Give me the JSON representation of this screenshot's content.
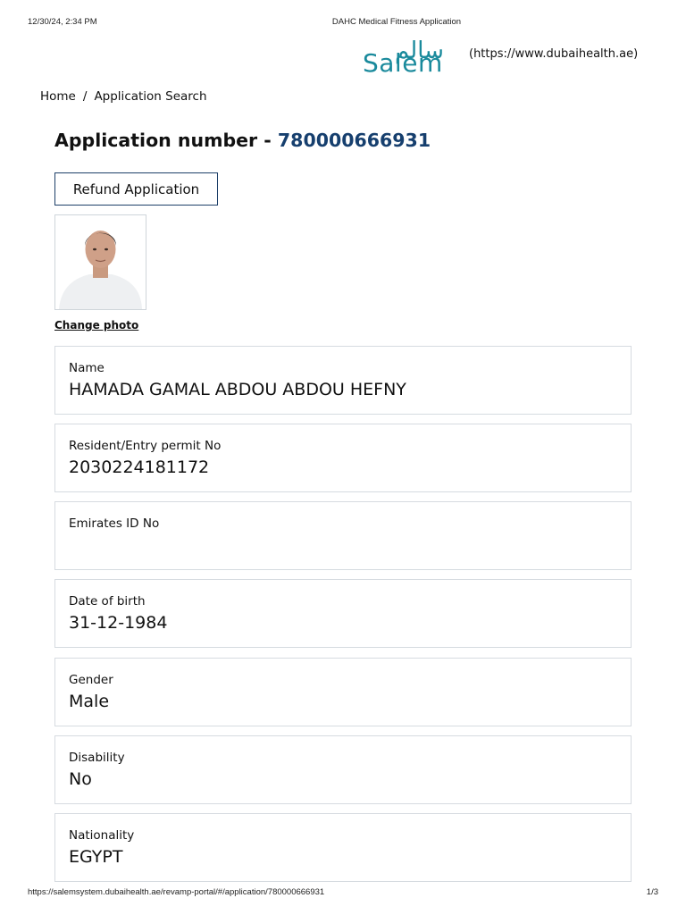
{
  "print_header": {
    "timestamp": "12/30/24, 2:34 PM",
    "title": "DAHC Medical Fitness Application"
  },
  "brand": {
    "arabic": "سالم",
    "latin": "Salem",
    "url": "(https://www.dubaihealth.ae)",
    "color": "#1a8a9c"
  },
  "breadcrumb": {
    "home": "Home",
    "separator": "/",
    "current": "Application Search"
  },
  "application": {
    "title_prefix": "Application number - ",
    "number": "780000666931",
    "number_color": "#163f6e"
  },
  "actions": {
    "refund_label": "Refund Application",
    "change_photo_label": "Change photo"
  },
  "fields": [
    {
      "label": "Name",
      "value": "HAMADA GAMAL ABDOU ABDOU HEFNY"
    },
    {
      "label": "Resident/Entry permit No",
      "value": "2030224181172"
    },
    {
      "label": "Emirates ID No",
      "value": ""
    },
    {
      "label": "Date of birth",
      "value": "31-12-1984"
    },
    {
      "label": "Gender",
      "value": "Male"
    },
    {
      "label": "Disability",
      "value": "No"
    },
    {
      "label": "Nationality",
      "value": "EGYPT"
    }
  ],
  "print_footer": {
    "url": "https://salemsystem.dubaihealth.ae/revamp-portal/#/application/780000666931",
    "page": "1/3"
  }
}
